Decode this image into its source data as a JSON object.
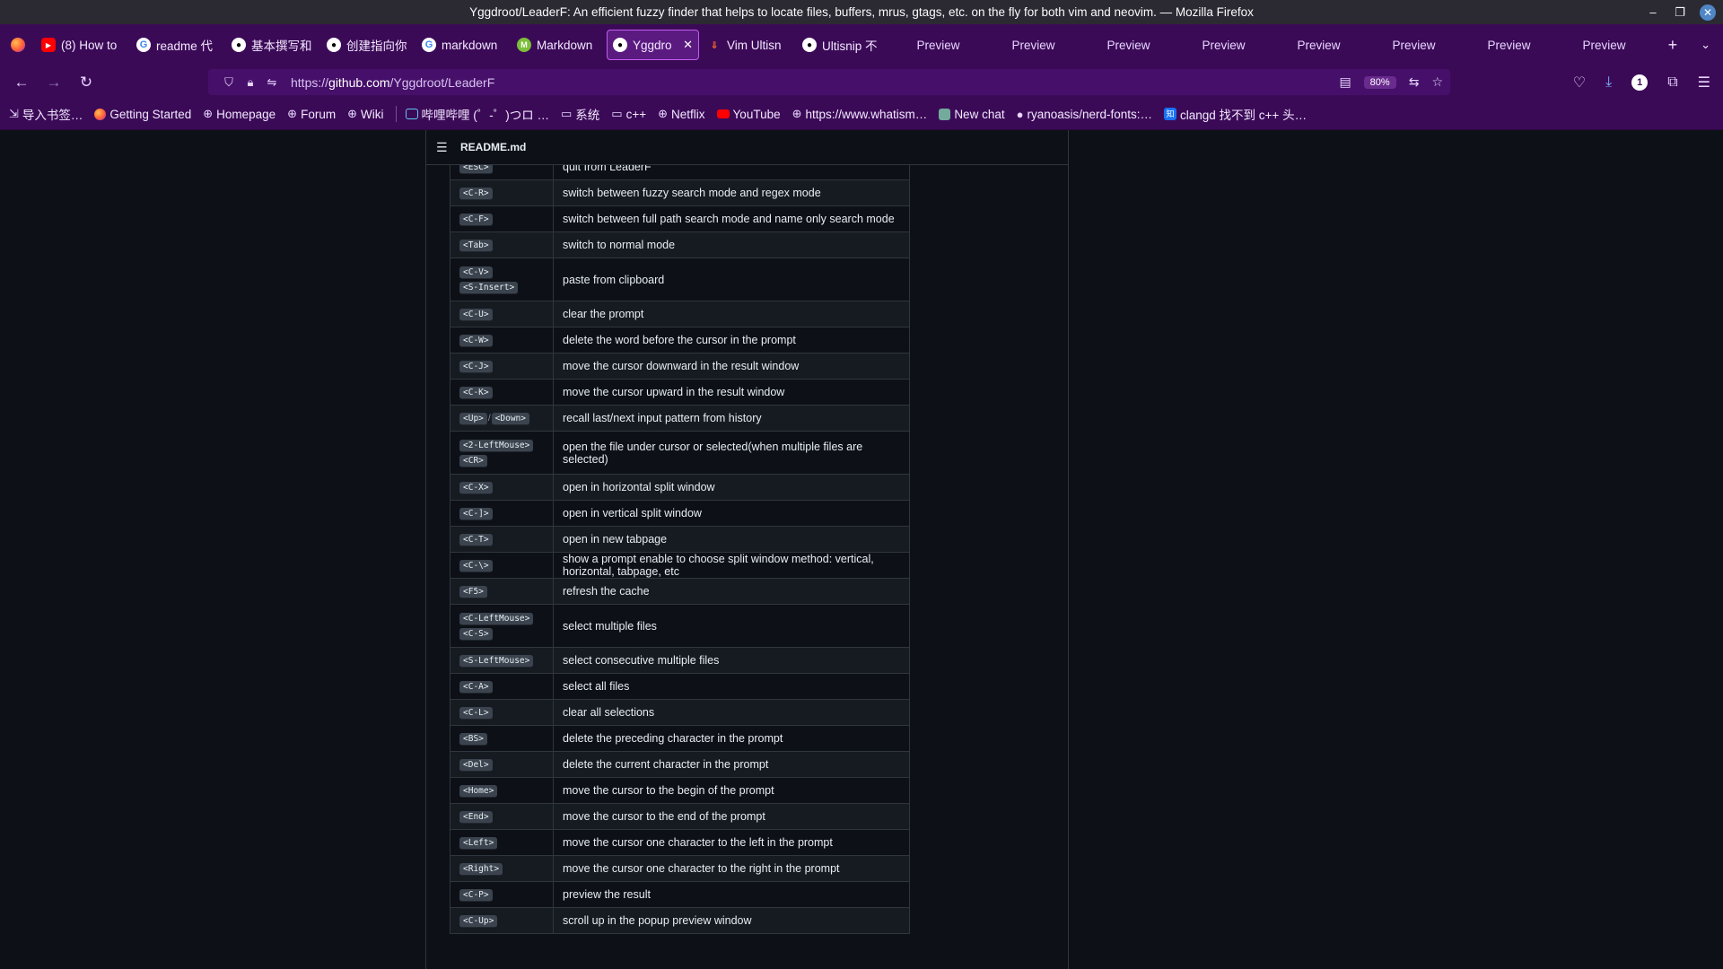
{
  "window": {
    "title": "Yggdroot/LeaderF: An efficient fuzzy finder that helps to locate files, buffers, mrus, gtags, etc. on the fly for both vim and neovim. — Mozilla Firefox"
  },
  "tabs": [
    {
      "label": "(8) How to",
      "icon": "youtube-icon"
    },
    {
      "label": "readme 代",
      "icon": "google-icon"
    },
    {
      "label": "基本撰写和",
      "icon": "github-icon"
    },
    {
      "label": "创建指向你",
      "icon": "github-icon"
    },
    {
      "label": "markdown",
      "icon": "google-icon"
    },
    {
      "label": "Markdown",
      "icon": "markdown-icon"
    },
    {
      "label": "Yggdro",
      "icon": "github-icon",
      "active": true
    },
    {
      "label": "Vim Ultisn",
      "icon": "vim-icon"
    },
    {
      "label": "Ultisnip 不",
      "icon": "github-icon"
    },
    {
      "label": "Preview"
    },
    {
      "label": "Preview"
    },
    {
      "label": "Preview"
    },
    {
      "label": "Preview"
    },
    {
      "label": "Preview"
    },
    {
      "label": "Preview"
    },
    {
      "label": "Preview"
    },
    {
      "label": "Preview"
    }
  ],
  "navbar": {
    "url_prefix": "https://",
    "url_host": "github.com",
    "url_path": "/Yggdroot/LeaderF",
    "zoom": "80%",
    "extension_badge": "1"
  },
  "bookmarks": [
    {
      "label": "导入书签…",
      "icon": "import-icon"
    },
    {
      "label": "Getting Started",
      "icon": "firefox-icon"
    },
    {
      "label": "Homepage",
      "icon": "globe-icon"
    },
    {
      "label": "Forum",
      "icon": "globe-icon"
    },
    {
      "label": "Wiki",
      "icon": "globe-icon"
    },
    {
      "label": "哔哩哔哩 (゜-゜)つロ …",
      "icon": "bilibili-icon"
    },
    {
      "label": "系统",
      "icon": "folder-icon"
    },
    {
      "label": "c++",
      "icon": "folder-icon"
    },
    {
      "label": "Netflix",
      "icon": "globe-icon"
    },
    {
      "label": "YouTube",
      "icon": "youtube-icon"
    },
    {
      "label": "https://www.whatism…",
      "icon": "globe-icon"
    },
    {
      "label": "New chat",
      "icon": "chatgpt-icon"
    },
    {
      "label": "ryanoasis/nerd-fonts:…",
      "icon": "github-icon"
    },
    {
      "label": "clangd 找不到 c++ 头…",
      "icon": "zhihu-icon"
    }
  ],
  "readme": {
    "filename": "README.md",
    "rows": [
      {
        "keys": [
          "<ESC>"
        ],
        "desc": "quit from LeaderF"
      },
      {
        "keys": [
          "<C-R>"
        ],
        "desc": "switch between fuzzy search mode and regex mode"
      },
      {
        "keys": [
          "<C-F>"
        ],
        "desc": "switch between full path search mode and name only search mode"
      },
      {
        "keys": [
          "<Tab>"
        ],
        "desc": "switch to normal mode"
      },
      {
        "keys": [
          "<C-V>",
          "<S-Insert>"
        ],
        "desc": "paste from clipboard",
        "tall": true
      },
      {
        "keys": [
          "<C-U>"
        ],
        "desc": "clear the prompt"
      },
      {
        "keys": [
          "<C-W>"
        ],
        "desc": "delete the word before the cursor in the prompt"
      },
      {
        "keys": [
          "<C-J>"
        ],
        "desc": "move the cursor downward in the result window"
      },
      {
        "keys": [
          "<C-K>"
        ],
        "desc": "move the cursor upward in the result window"
      },
      {
        "keys": [
          "<Up>",
          "<Down>"
        ],
        "inline": true,
        "desc": "recall last/next input pattern from history"
      },
      {
        "keys": [
          "<2-LeftMouse>",
          "<CR>"
        ],
        "desc": "open the file under cursor or selected(when multiple files are selected)",
        "tall": true
      },
      {
        "keys": [
          "<C-X>"
        ],
        "desc": "open in horizontal split window"
      },
      {
        "keys": [
          "<C-]>"
        ],
        "desc": "open in vertical split window"
      },
      {
        "keys": [
          "<C-T>"
        ],
        "desc": "open in new tabpage"
      },
      {
        "keys": [
          "<C-\\>"
        ],
        "desc": "show a prompt enable to choose split window method: vertical, horizontal, tabpage, etc"
      },
      {
        "keys": [
          "<F5>"
        ],
        "desc": "refresh the cache"
      },
      {
        "keys": [
          "<C-LeftMouse>",
          "<C-S>"
        ],
        "desc": "select multiple files",
        "tall": true
      },
      {
        "keys": [
          "<S-LeftMouse>"
        ],
        "desc": "select consecutive multiple files"
      },
      {
        "keys": [
          "<C-A>"
        ],
        "desc": "select all files"
      },
      {
        "keys": [
          "<C-L>"
        ],
        "desc": "clear all selections"
      },
      {
        "keys": [
          "<BS>"
        ],
        "desc": "delete the preceding character in the prompt"
      },
      {
        "keys": [
          "<Del>"
        ],
        "desc": "delete the current character in the prompt"
      },
      {
        "keys": [
          "<Home>"
        ],
        "desc": "move the cursor to the begin of the prompt"
      },
      {
        "keys": [
          "<End>"
        ],
        "desc": "move the cursor to the end of the prompt"
      },
      {
        "keys": [
          "<Left>"
        ],
        "desc": "move the cursor one character to the left in the prompt"
      },
      {
        "keys": [
          "<Right>"
        ],
        "desc": "move the cursor one character to the right in the prompt"
      },
      {
        "keys": [
          "<C-P>"
        ],
        "desc": "preview the result"
      },
      {
        "keys": [
          "<C-Up>"
        ],
        "desc": "scroll up in the popup preview window"
      }
    ]
  },
  "colors": {
    "browser_theme": "#3b0a57",
    "page_background": "#0d1117",
    "accent_active_tab": "#c25cf0"
  }
}
